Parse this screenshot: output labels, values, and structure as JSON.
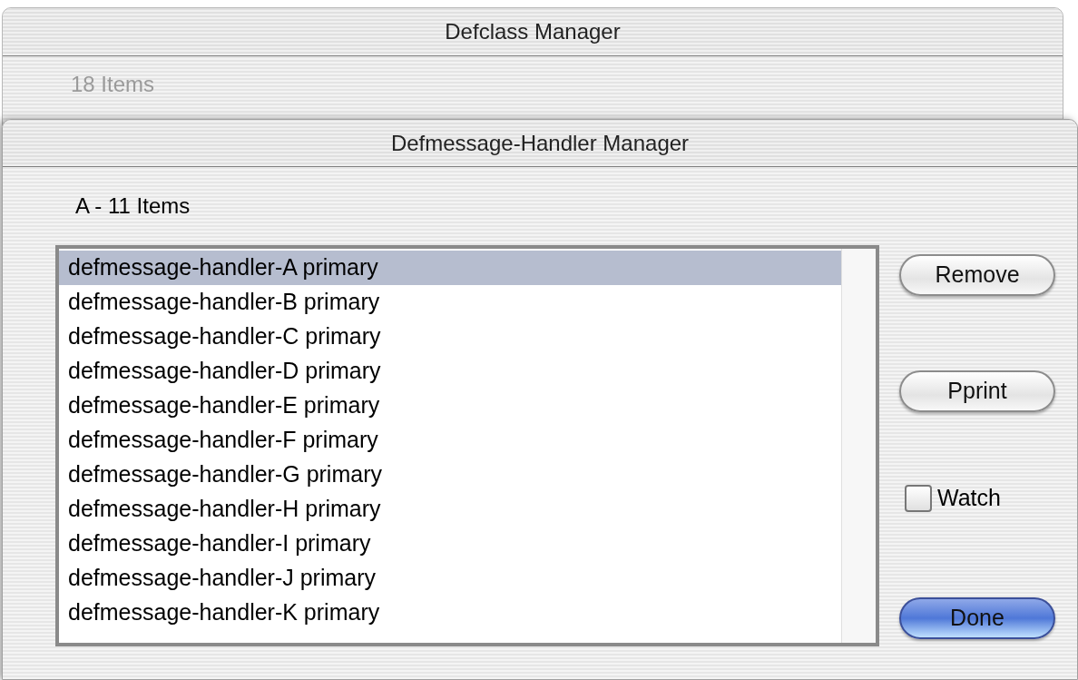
{
  "back_window": {
    "title": "Defclass Manager",
    "count": "18 Items"
  },
  "window": {
    "title": "Defmessage-Handler Manager",
    "count": "A - 11 Items"
  },
  "handlers": [
    {
      "label": "defmessage-handler-A primary",
      "selected": true
    },
    {
      "label": "defmessage-handler-B primary",
      "selected": false
    },
    {
      "label": "defmessage-handler-C primary",
      "selected": false
    },
    {
      "label": "defmessage-handler-D primary",
      "selected": false
    },
    {
      "label": "defmessage-handler-E primary",
      "selected": false
    },
    {
      "label": "defmessage-handler-F primary",
      "selected": false
    },
    {
      "label": "defmessage-handler-G primary",
      "selected": false
    },
    {
      "label": "defmessage-handler-H primary",
      "selected": false
    },
    {
      "label": "defmessage-handler-I primary",
      "selected": false
    },
    {
      "label": "defmessage-handler-J primary",
      "selected": false
    },
    {
      "label": "defmessage-handler-K primary",
      "selected": false
    }
  ],
  "buttons": [
    {
      "label": "Remove",
      "kind": "plain"
    },
    {
      "label": "Pprint",
      "kind": "plain"
    },
    {
      "label": "Done",
      "kind": "default"
    }
  ],
  "watch": {
    "label": "Watch",
    "checked": false
  }
}
